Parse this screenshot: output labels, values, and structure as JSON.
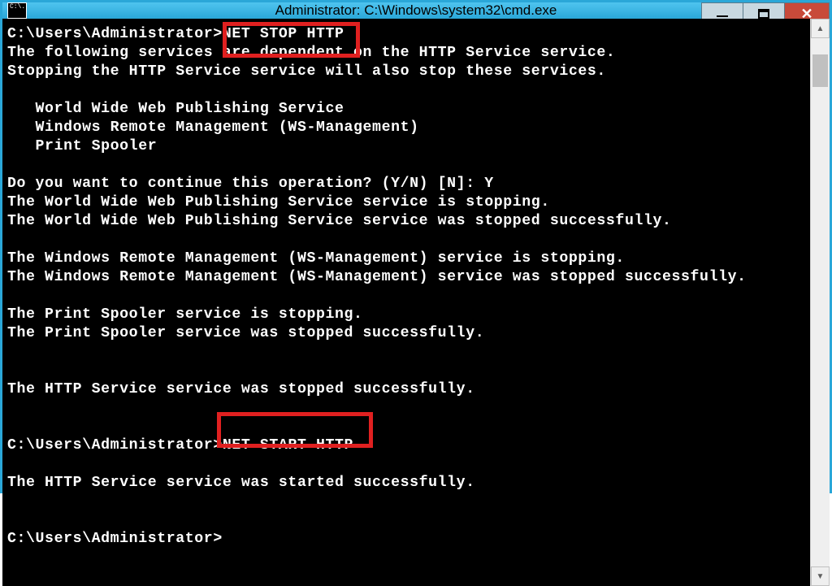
{
  "window": {
    "title": "Administrator: C:\\Windows\\system32\\cmd.exe",
    "app_icon_text": "C:\\."
  },
  "console": {
    "prompt1": "C:\\Users\\Administrator>",
    "cmd1": "NET STOP HTTP",
    "line1": "The following services are dependent on the HTTP Service service.",
    "line2": "Stopping the HTTP Service service will also stop these services.",
    "blank": "",
    "svc1": "   World Wide Web Publishing Service",
    "svc2": "   Windows Remote Management (WS-Management)",
    "svc3": "   Print Spooler",
    "confirm": "Do you want to continue this operation? (Y/N) [N]: Y",
    "stop1a": "The World Wide Web Publishing Service service is stopping.",
    "stop1b": "The World Wide Web Publishing Service service was stopped successfully.",
    "stop2a": "The Windows Remote Management (WS-Management) service is stopping.",
    "stop2b": "The Windows Remote Management (WS-Management) service was stopped successfully.",
    "stop3a": "The Print Spooler service is stopping.",
    "stop3b": "The Print Spooler service was stopped successfully.",
    "httpstop": "The HTTP Service service was stopped successfully.",
    "prompt2": "C:\\Users\\Administrator>",
    "cmd2": "NET START HTTP",
    "httpstart": "The HTTP Service service was started successfully.",
    "prompt3": "C:\\Users\\Administrator>"
  },
  "controls": {
    "minimize": "minimize",
    "maximize": "maximize",
    "close": "close"
  },
  "highlights": {
    "box1": "NET STOP HTTP",
    "box2": "NET START HTTP"
  }
}
